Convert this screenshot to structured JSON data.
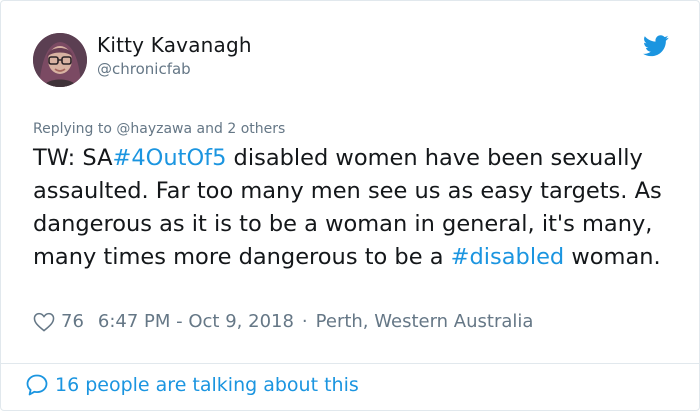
{
  "author": {
    "display_name": "Kitty Kavanagh",
    "handle": "@chronicfab",
    "avatar_icon": "user-avatar-photo"
  },
  "brand": {
    "icon": "twitter-bird-icon",
    "color": "#1b95e0"
  },
  "reply_context": {
    "prefix": "Replying to ",
    "mention": "@hayzawa",
    "suffix": " and 2 others"
  },
  "tweet": {
    "seg1": "TW: SA",
    "hashtag1": "#4OutOf5",
    "seg2": " disabled women have been sexually assaulted. Far too many men see us as easy targets. As dangerous as it is to be a woman in general, it's many, many times more dangerous to be a ",
    "hashtag2": "#disabled",
    "seg3": " woman."
  },
  "meta": {
    "likes": "76",
    "timestamp": "6:47 PM - Oct 9, 2018",
    "separator": "·",
    "location": "Perth, Western Australia",
    "like_icon": "heart-outline-icon"
  },
  "footer": {
    "conversation_label": "16 people are talking about this",
    "conversation_icon": "speech-bubble-icon"
  },
  "colors": {
    "text": "#14171a",
    "secondary": "#657786",
    "link": "#1b95e0",
    "border": "#e1e8ed"
  }
}
